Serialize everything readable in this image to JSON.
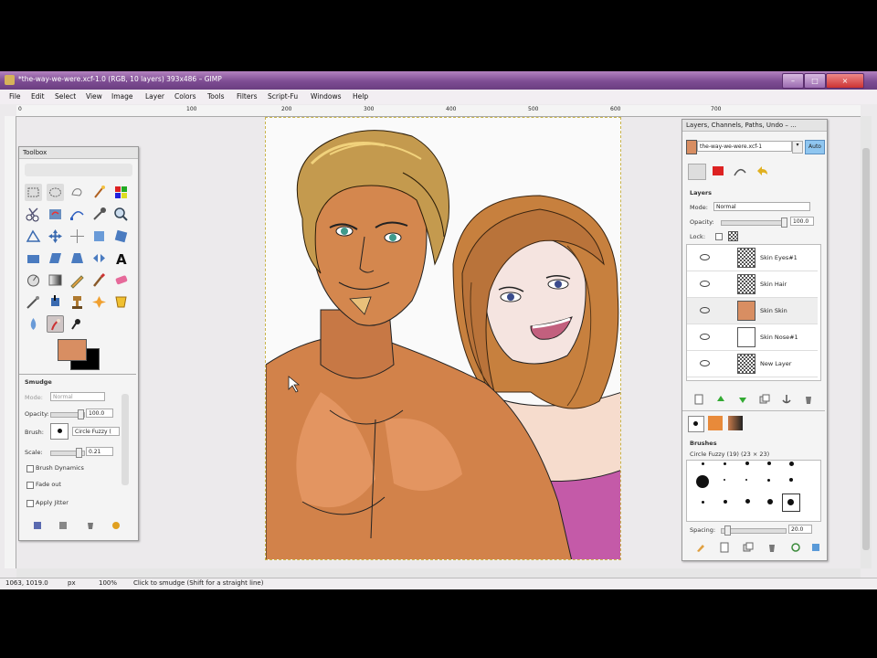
{
  "window": {
    "title": "*the-way-we-were.xcf-1.0 (RGB, 10 layers) 393x486 – GIMP",
    "controls": {
      "minimize": "–",
      "maximize": "□",
      "close": "×"
    }
  },
  "menubar": {
    "items": [
      "File",
      "Edit",
      "Select",
      "View",
      "Image",
      "Layer",
      "Colors",
      "Tools",
      "Filters",
      "Script-Fu",
      "Windows",
      "Help"
    ]
  },
  "rulers": {
    "h_labels": [
      "0",
      "100",
      "200",
      "300",
      "400",
      "500",
      "600",
      "700"
    ]
  },
  "toolbox": {
    "title": "Toolbox",
    "tool_options": {
      "title": "Smudge",
      "mode_label": "Mode:",
      "mode_value": "Normal",
      "opacity_label": "Opacity:",
      "opacity_value": "100.0",
      "brush_label": "Brush:",
      "brush_value": "Circle Fuzzy (",
      "scale_label": "Scale:",
      "scale_value": "0.21",
      "brush_dynamics": "Brush Dynamics",
      "fade_out": "Fade out",
      "apply_jitter": "Apply Jitter"
    },
    "colors": {
      "foreground": "#d88e62",
      "background": "#000000"
    }
  },
  "layers_dock": {
    "title": "Layers, Channels, Paths, Undo – ...",
    "image_select": "the-way-we-were.xcf-1",
    "auto_label": "Auto",
    "section_title": "Layers",
    "mode_label": "Mode:",
    "mode_value": "Normal",
    "opacity_label": "Opacity:",
    "opacity_value": "100.0",
    "lock_label": "Lock:",
    "layers": [
      {
        "name": "Skin Eyes#1",
        "thumb": "checker"
      },
      {
        "name": "Skin Hair",
        "thumb": "checker"
      },
      {
        "name": "Skin Skin",
        "thumb": "skin"
      },
      {
        "name": "Skin Nose#1",
        "thumb": "white"
      },
      {
        "name": "New Layer",
        "thumb": "checker"
      }
    ],
    "brushes": {
      "section_title": "Brushes",
      "selected": "Circle Fuzzy (19) (23 × 23)",
      "spacing_label": "Spacing:",
      "spacing_value": "20.0"
    }
  },
  "statusbar": {
    "coords": "1063, 1019.0",
    "unit": "px",
    "zoom": "100%",
    "message": "Click to smudge (Shift for a straight line)"
  }
}
